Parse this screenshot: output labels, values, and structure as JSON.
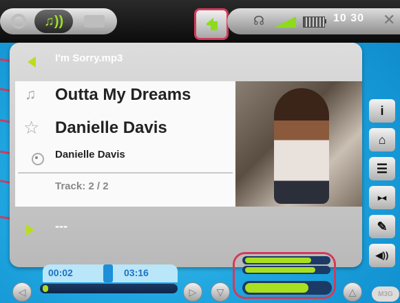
{
  "top_bar": {
    "mode_music_symbol": "♫))",
    "clock": "10 30",
    "headphones_icon": "headphones-icon",
    "tools_icon": "tools-icon"
  },
  "panel": {
    "filename": "I'm Sorry.mp3",
    "title": "Outta My Dreams",
    "artist": "Danielle Davis",
    "album": "Danielle Davis",
    "track": "Track: 2 / 2",
    "next_track": "---"
  },
  "side_buttons": [
    {
      "icon": "info-icon",
      "glyph": "i"
    },
    {
      "icon": "home-icon",
      "glyph": "⌂"
    },
    {
      "icon": "list-icon",
      "glyph": "☰"
    },
    {
      "icon": "playback-mode-icon",
      "glyph": "▸◂"
    },
    {
      "icon": "wrench-icon",
      "glyph": "✎"
    },
    {
      "icon": "volume-icon",
      "glyph": "◀))"
    }
  ],
  "playback": {
    "elapsed": "00:02",
    "total": "03:16",
    "progress_fraction": 0.01
  },
  "volume": {
    "level_fraction": 0.75
  },
  "eq_levels": [
    0.8,
    0.85
  ],
  "model_label": "M3G",
  "colors": {
    "accent_green": "#a8e020",
    "callout_red": "#d33a5a",
    "time_blue": "#1c72c4"
  }
}
